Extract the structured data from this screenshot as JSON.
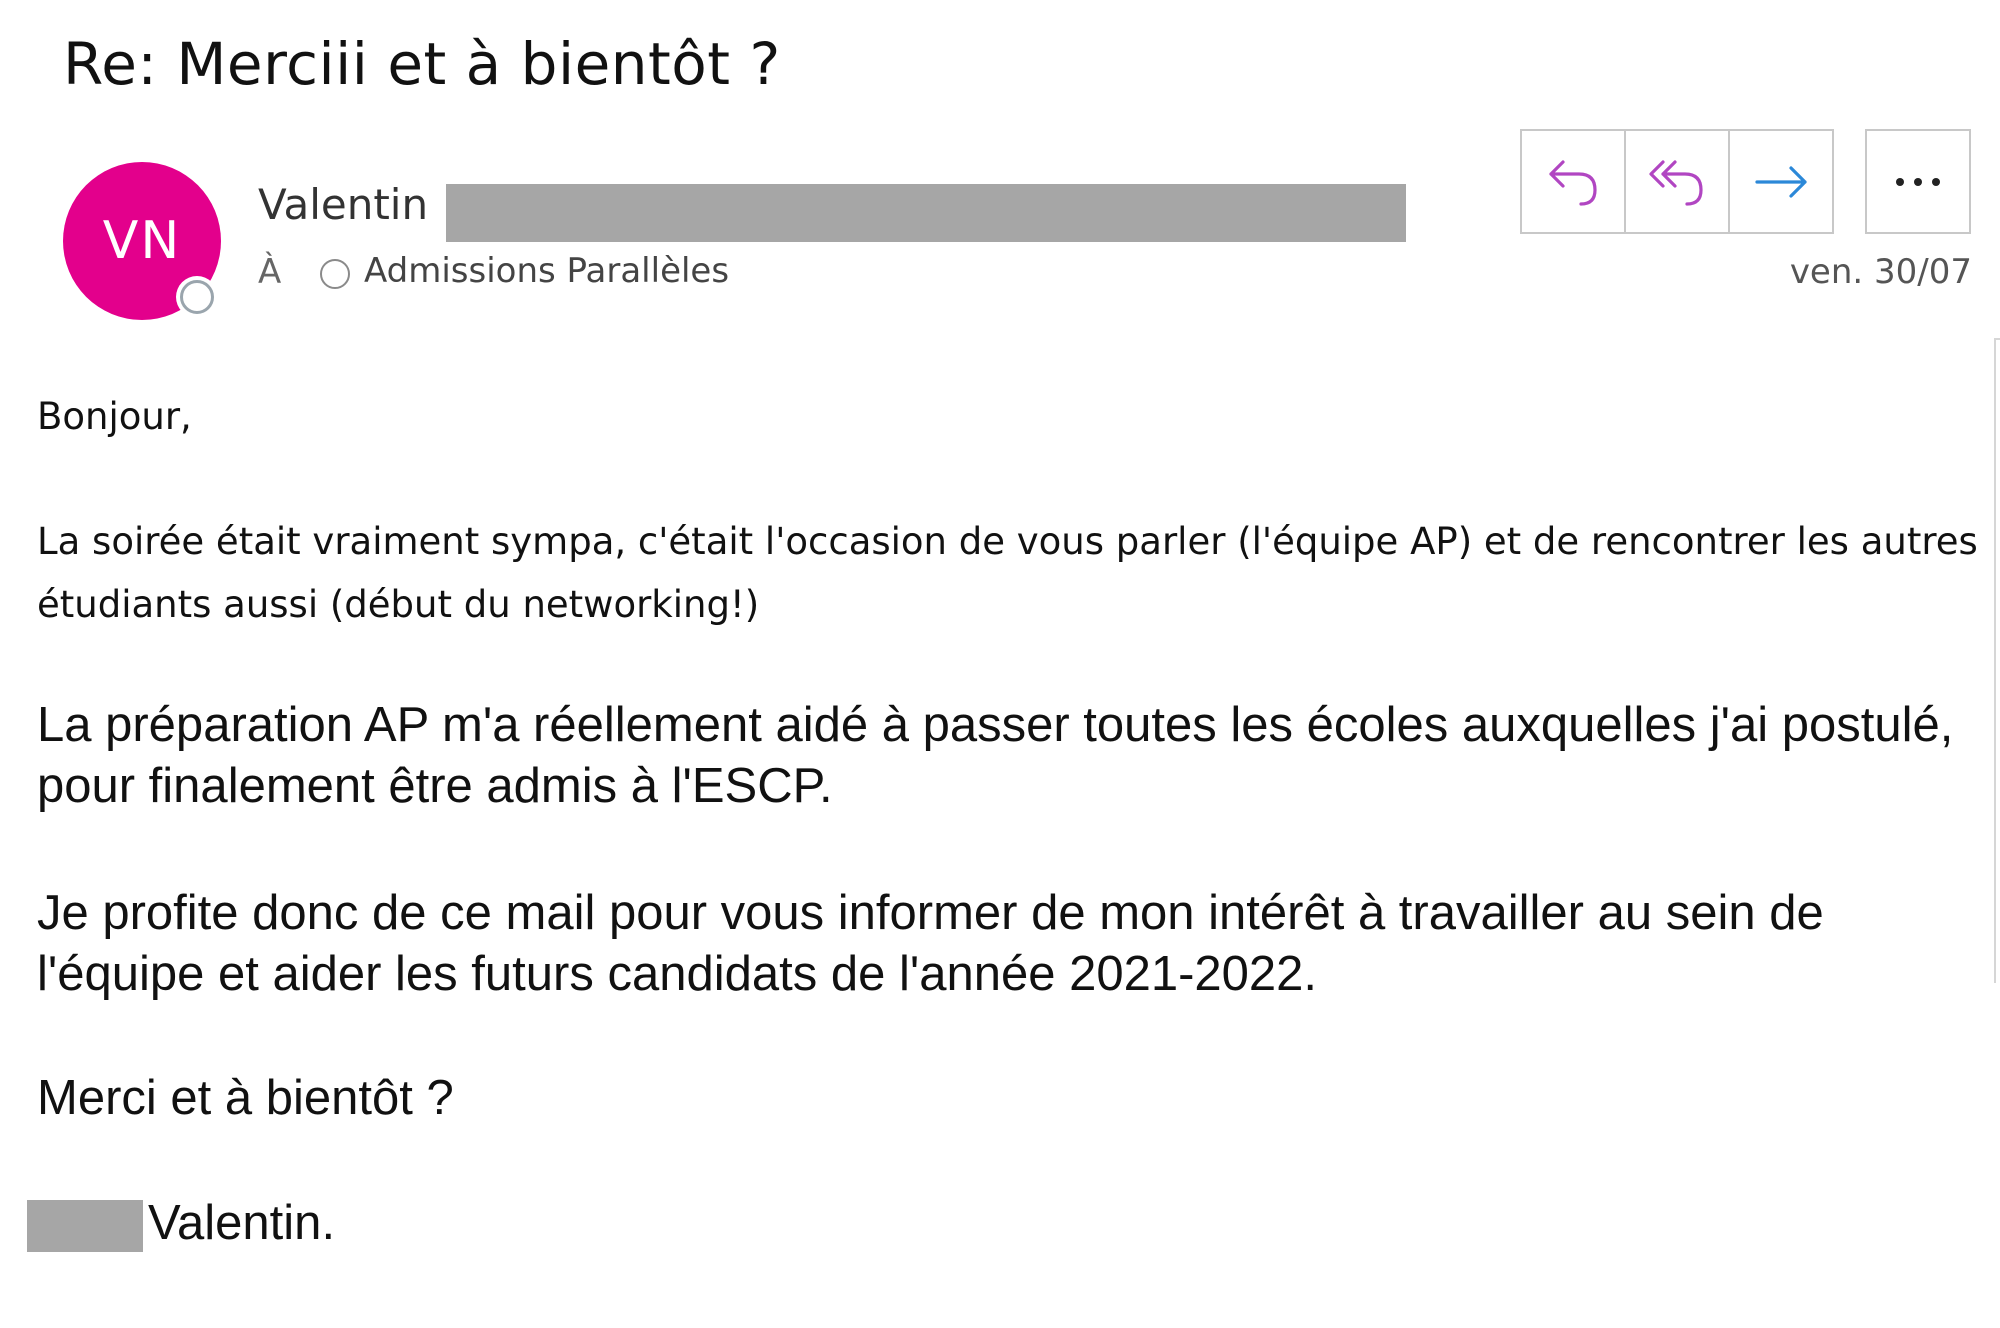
{
  "email": {
    "subject": "Re: Merciii et à bientôt ?",
    "avatar": {
      "initials": "VN",
      "color": "#e3008c"
    },
    "sender_name": "Valentin",
    "to_label": "À",
    "recipient": "Admissions Parallèles",
    "date": "ven. 30/07"
  },
  "actions": {
    "reply_icon": "reply-icon",
    "reply_all_icon": "reply-all-icon",
    "forward_icon": "forward-icon",
    "more_icon": "more-icon",
    "reply_color": "#b146c2",
    "forward_color": "#2b88d8"
  },
  "body": {
    "greeting": "Bonjour,",
    "para1": "La soirée était vraiment sympa, c'était l'occasion de vous parler (l'équipe AP) et de rencontrer les autres étudiants aussi (début du networking!)",
    "para2": "La préparation AP m'a réellement aidé à passer toutes les écoles auxquelles j'ai postulé, pour finalement être admis à l'ESCP.",
    "para3": "Je profite donc de ce mail pour vous informer de mon intérêt à travailler au sein de l'équipe et aider les futurs candidats de l'année 2021-2022.",
    "closing": "Merci et à bientôt ?",
    "signature": "Valentin."
  }
}
